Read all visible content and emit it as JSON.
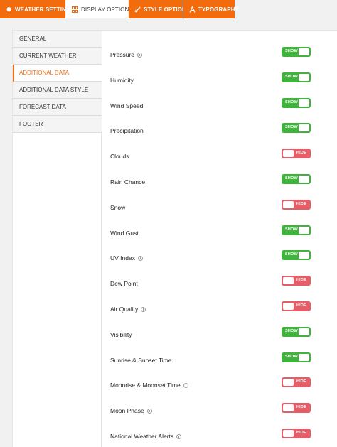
{
  "tabs": [
    {
      "label": "WEATHER SETTINGS",
      "icon": "cloud-icon"
    },
    {
      "label": "DISPLAY OPTIONS",
      "icon": "grid-icon"
    },
    {
      "label": "STYLE OPTIONS",
      "icon": "brush-icon"
    },
    {
      "label": "TYPOGRAPHY",
      "icon": "font-icon"
    }
  ],
  "active_tab": "DISPLAY OPTIONS",
  "sidebar": {
    "items": [
      {
        "label": "GENERAL"
      },
      {
        "label": "CURRENT WEATHER"
      },
      {
        "label": "ADDITIONAL DATA"
      },
      {
        "label": "ADDITIONAL DATA STYLE"
      },
      {
        "label": "FORECAST DATA"
      },
      {
        "label": "FOOTER"
      }
    ],
    "active": "ADDITIONAL DATA"
  },
  "options": [
    {
      "label": "Pressure",
      "info": true,
      "state": "SHOW"
    },
    {
      "label": "Humidity",
      "info": false,
      "state": "SHOW"
    },
    {
      "label": "Wind Speed",
      "info": false,
      "state": "SHOW"
    },
    {
      "label": "Precipitation",
      "info": false,
      "state": "SHOW"
    },
    {
      "label": "Clouds",
      "info": false,
      "state": "HIDE"
    },
    {
      "label": "Rain Chance",
      "info": false,
      "state": "SHOW"
    },
    {
      "label": "Snow",
      "info": false,
      "state": "HIDE"
    },
    {
      "label": "Wind Gust",
      "info": false,
      "state": "SHOW"
    },
    {
      "label": "UV Index",
      "info": true,
      "state": "SHOW"
    },
    {
      "label": "Dew Point",
      "info": false,
      "state": "HIDE"
    },
    {
      "label": "Air Quality",
      "info": true,
      "state": "HIDE"
    },
    {
      "label": "Visibility",
      "info": false,
      "state": "SHOW"
    },
    {
      "label": "Sunrise & Sunset Time",
      "info": false,
      "state": "SHOW"
    },
    {
      "label": "Moonrise & Moonset Time",
      "info": true,
      "state": "HIDE"
    },
    {
      "label": "Moon Phase",
      "info": true,
      "state": "HIDE"
    },
    {
      "label": "National Weather Alerts",
      "info": true,
      "state": "HIDE"
    }
  ],
  "colors": {
    "accent": "#f26c0d",
    "show": "#3fb33b",
    "hide": "#e45d67"
  }
}
